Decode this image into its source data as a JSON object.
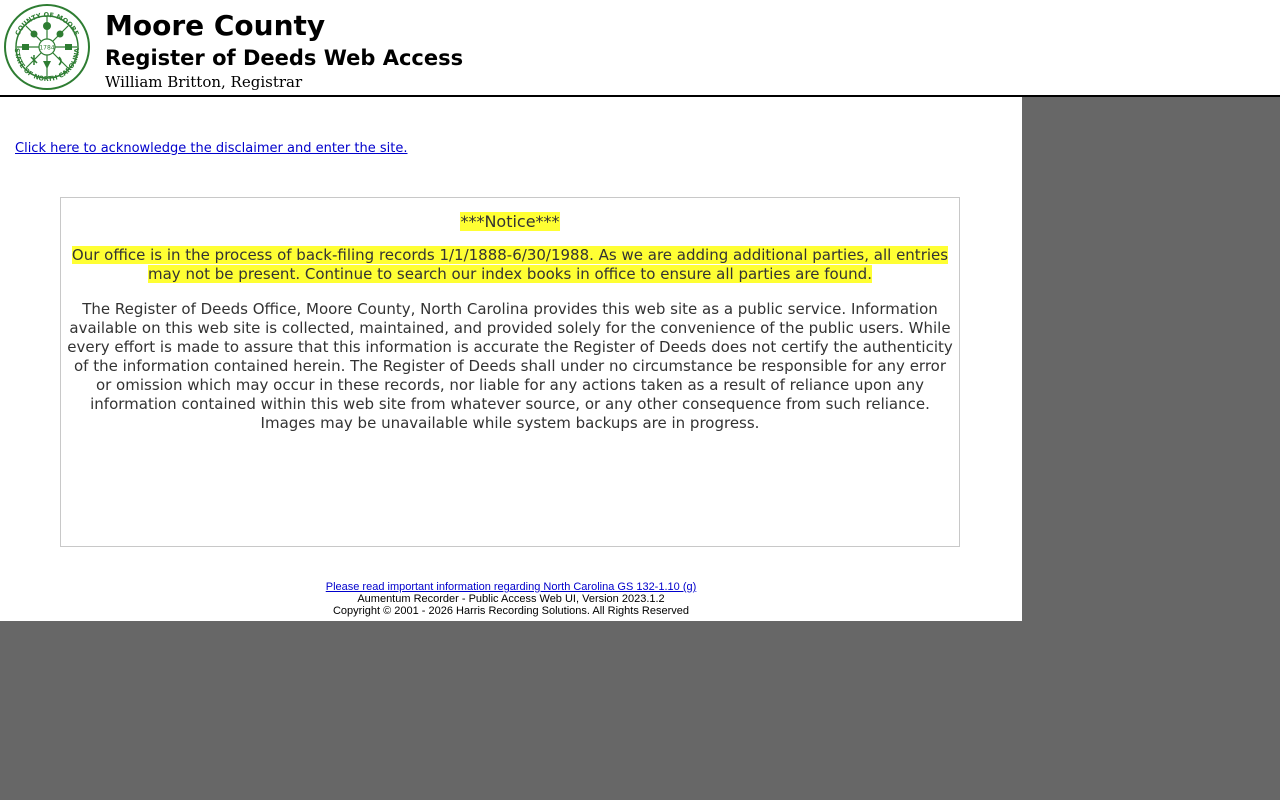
{
  "header": {
    "county_name": "Moore County",
    "site_name": "Register of Deeds Web Access",
    "registrar": "William Britton, Registrar",
    "seal": {
      "top_text": "COUNTY OF MOORE",
      "bottom_text": "STATE OF NORTH CAROLINA",
      "year": "1784",
      "color": "#2e7d32"
    }
  },
  "main": {
    "enter_link": "Click here to acknowledge the disclaimer and enter the site.",
    "notice_title": "***Notice***",
    "notice_text": "Our office is in the process of back-filing records 1/1/1888-6/30/1988. As we are adding additional parties, all entries may not be present. Continue to search our index books in office to ensure all parties are found.",
    "disclaimer": "The Register of Deeds Office, Moore County, North Carolina provides this web site as a public service. Information available on this web site is collected, maintained, and provided solely for the convenience of the public users. While every effort is made to assure that this information is accurate the Register of Deeds does not certify the authenticity of the information contained herein. The Register of Deeds shall under no circumstance be responsible for any error or omission which may occur in these records, nor liable for any actions taken as a result of reliance upon any information contained within this web site from whatever source, or any other consequence from such reliance. Images may be unavailable while system backups are in progress."
  },
  "footer": {
    "gs_link": "Please read important information regarding North Carolina GS 132-1.10 (g)",
    "version": "Aumentum Recorder - Public Access Web UI, Version 2023.1.2",
    "copyright": "Copyright © 2001 - 2026  Harris Recording Solutions. All Rights Reserved"
  },
  "colors": {
    "highlight": "#ffff33",
    "link": "#0000cc",
    "background": "#676767",
    "seal": "#2e7d32"
  }
}
